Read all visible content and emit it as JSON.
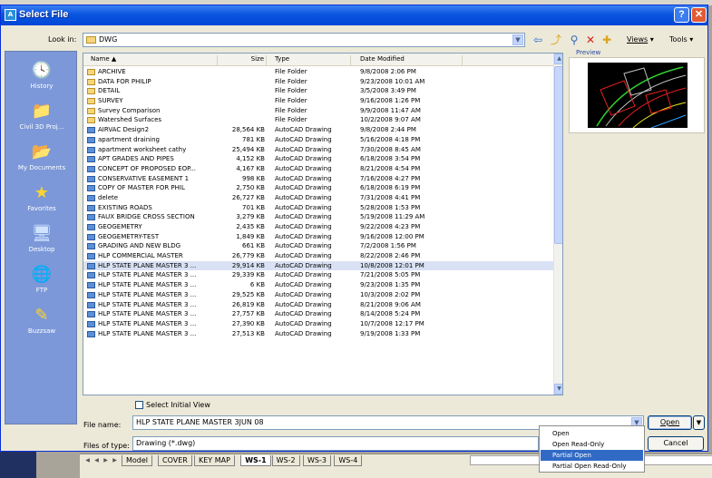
{
  "dialog": {
    "title": "Select File"
  },
  "lookin": {
    "label": "Look in:",
    "value": "DWG"
  },
  "toolbar": {
    "views_label": "Views",
    "tools_label": "Tools"
  },
  "places": [
    {
      "label": "History",
      "icon": "history-icon"
    },
    {
      "label": "Civil 3D Proj...",
      "icon": "folder-icon"
    },
    {
      "label": "My Documents",
      "icon": "my-documents-icon"
    },
    {
      "label": "Favorites",
      "icon": "star-icon"
    },
    {
      "label": "Desktop",
      "icon": "desktop-icon"
    },
    {
      "label": "FTP",
      "icon": "ftp-icon"
    },
    {
      "label": "Buzzsaw",
      "icon": "buzzsaw-icon"
    }
  ],
  "columns": {
    "name": "Name",
    "size": "Size",
    "type": "Type",
    "date": "Date Modified"
  },
  "files": [
    {
      "name": "ARCHIVE",
      "size": "",
      "type": "File Folder",
      "date": "9/8/2008 2:06 PM",
      "kind": "folder"
    },
    {
      "name": "DATA FOR PHILIP",
      "size": "",
      "type": "File Folder",
      "date": "9/23/2008 10:01 AM",
      "kind": "folder"
    },
    {
      "name": "DETAIL",
      "size": "",
      "type": "File Folder",
      "date": "3/5/2008 3:49 PM",
      "kind": "folder"
    },
    {
      "name": "SURVEY",
      "size": "",
      "type": "File Folder",
      "date": "9/16/2008 1:26 PM",
      "kind": "folder"
    },
    {
      "name": "Survey Comparison",
      "size": "",
      "type": "File Folder",
      "date": "9/9/2008 11:47 AM",
      "kind": "folder"
    },
    {
      "name": "Watershed Surfaces",
      "size": "",
      "type": "File Folder",
      "date": "10/2/2008 9:07 AM",
      "kind": "folder"
    },
    {
      "name": "AIRVAC Design2",
      "size": "28,564 KB",
      "type": "AutoCAD Drawing",
      "date": "9/8/2008 2:44 PM",
      "kind": "dwg"
    },
    {
      "name": "apartment draining",
      "size": "781 KB",
      "type": "AutoCAD Drawing",
      "date": "5/16/2008 4:18 PM",
      "kind": "dwg"
    },
    {
      "name": "apartment worksheet cathy",
      "size": "25,494 KB",
      "type": "AutoCAD Drawing",
      "date": "7/30/2008 8:45 AM",
      "kind": "dwg"
    },
    {
      "name": "APT GRADES AND PIPES",
      "size": "4,152 KB",
      "type": "AutoCAD Drawing",
      "date": "6/18/2008 3:54 PM",
      "kind": "dwg"
    },
    {
      "name": "CONCEPT OF PROPOSED EOP...",
      "size": "4,167 KB",
      "type": "AutoCAD Drawing",
      "date": "8/21/2008 4:54 PM",
      "kind": "dwg"
    },
    {
      "name": "CONSERVATIVE EASEMENT 1",
      "size": "998 KB",
      "type": "AutoCAD Drawing",
      "date": "7/16/2008 4:27 PM",
      "kind": "dwg"
    },
    {
      "name": "COPY OF MASTER FOR PHIL",
      "size": "2,750 KB",
      "type": "AutoCAD Drawing",
      "date": "6/18/2008 6:19 PM",
      "kind": "dwg"
    },
    {
      "name": "delete",
      "size": "26,727 KB",
      "type": "AutoCAD Drawing",
      "date": "7/31/2008 4:41 PM",
      "kind": "dwg"
    },
    {
      "name": "EXISTING ROADS",
      "size": "701 KB",
      "type": "AutoCAD Drawing",
      "date": "5/28/2008 1:53 PM",
      "kind": "dwg"
    },
    {
      "name": "FAUX BRIDGE CROSS SECTION",
      "size": "3,279 KB",
      "type": "AutoCAD Drawing",
      "date": "5/19/2008 11:29 AM",
      "kind": "dwg"
    },
    {
      "name": "GEOGEMETRY",
      "size": "2,435 KB",
      "type": "AutoCAD Drawing",
      "date": "9/22/2008 4:23 PM",
      "kind": "dwg"
    },
    {
      "name": "GEOGEMETRY-TEST",
      "size": "1,849 KB",
      "type": "AutoCAD Drawing",
      "date": "9/16/2008 12:00 PM",
      "kind": "dwg"
    },
    {
      "name": "GRADING AND NEW BLDG",
      "size": "661 KB",
      "type": "AutoCAD Drawing",
      "date": "7/2/2008 1:56 PM",
      "kind": "dwg"
    },
    {
      "name": "HLP COMMERCIAL MASTER",
      "size": "26,779 KB",
      "type": "AutoCAD Drawing",
      "date": "8/22/2008 2:46 PM",
      "kind": "dwg"
    },
    {
      "name": "HLP STATE PLANE MASTER 3 ...",
      "size": "29,914 KB",
      "type": "AutoCAD Drawing",
      "date": "10/8/2008 12:01 PM",
      "kind": "dwg",
      "selected": true
    },
    {
      "name": "HLP STATE PLANE MASTER 3 ...",
      "size": "29,339 KB",
      "type": "AutoCAD Drawing",
      "date": "7/21/2008 5:05 PM",
      "kind": "dwg"
    },
    {
      "name": "HLP STATE PLANE MASTER 3 ...",
      "size": "6 KB",
      "type": "AutoCAD Drawing",
      "date": "9/23/2008 1:35 PM",
      "kind": "dwg"
    },
    {
      "name": "HLP STATE PLANE MASTER 3 ...",
      "size": "29,525 KB",
      "type": "AutoCAD Drawing",
      "date": "10/3/2008 2:02 PM",
      "kind": "dwg"
    },
    {
      "name": "HLP STATE PLANE MASTER 3 ...",
      "size": "26,819 KB",
      "type": "AutoCAD Drawing",
      "date": "8/21/2008 9:06 AM",
      "kind": "dwg"
    },
    {
      "name": "HLP STATE PLANE MASTER 3 ...",
      "size": "27,757 KB",
      "type": "AutoCAD Drawing",
      "date": "8/14/2008 5:24 PM",
      "kind": "dwg"
    },
    {
      "name": "HLP STATE PLANE MASTER 3 ...",
      "size": "27,390 KB",
      "type": "AutoCAD Drawing",
      "date": "10/7/2008 12:17 PM",
      "kind": "dwg"
    },
    {
      "name": "HLP STATE PLANE MASTER 3 ...",
      "size": "27,513 KB",
      "type": "AutoCAD Drawing",
      "date": "9/19/2008 1:33 PM",
      "kind": "dwg"
    }
  ],
  "preview": {
    "label": "Preview"
  },
  "select_initial_view": {
    "label": "Select Initial View"
  },
  "filename": {
    "label": "File name:",
    "value": "HLP STATE PLANE MASTER 3JUN 08"
  },
  "filetype": {
    "label": "Files of type:",
    "value": "Drawing (*.dwg)"
  },
  "buttons": {
    "open": "Open",
    "cancel": "Cancel"
  },
  "open_menu": [
    {
      "label": "Open"
    },
    {
      "label": "Open Read-Only"
    },
    {
      "label": "Partial Open",
      "highlighted": true
    },
    {
      "label": "Partial Open Read-Only"
    }
  ],
  "layout_tabs": [
    {
      "label": "Model"
    },
    {
      "label": "COVER"
    },
    {
      "label": "KEY MAP"
    },
    {
      "label": "WS-1",
      "active": true
    },
    {
      "label": "WS-2"
    },
    {
      "label": "WS-3"
    },
    {
      "label": "WS-4"
    }
  ],
  "colors": {
    "titlebar": "#0a55e0",
    "places_bar": "#7c98d8",
    "selection": "#316ac5"
  }
}
